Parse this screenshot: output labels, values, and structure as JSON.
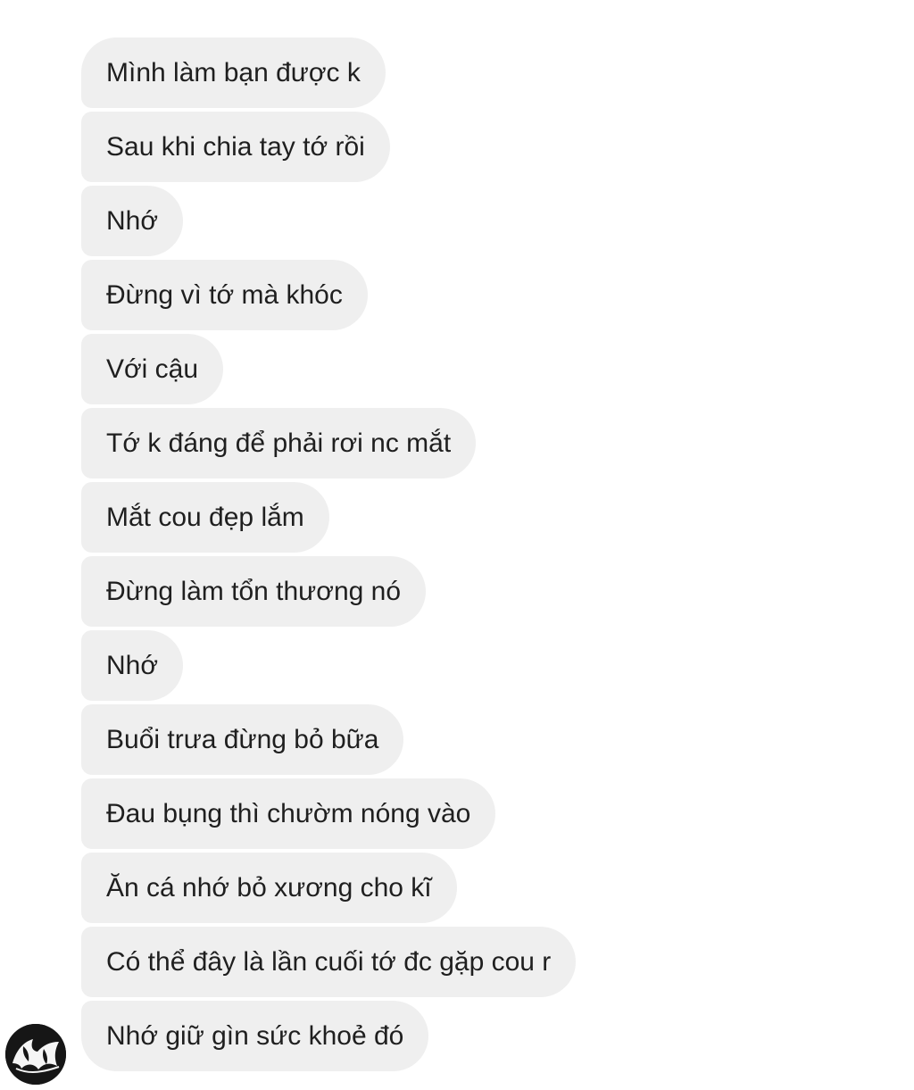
{
  "conversation": {
    "messages": [
      {
        "text": "Mình làm bạn được k"
      },
      {
        "text": "Sau khi chia tay tớ rồi"
      },
      {
        "text": "Nhớ"
      },
      {
        "text": "Đừng vì tớ mà khóc"
      },
      {
        "text": "Với cậu"
      },
      {
        "text": "Tớ k đáng để phải rơi nc mắt"
      },
      {
        "text": "Mắt cou đẹp lắm"
      },
      {
        "text": "Đừng làm tổn thương nó"
      },
      {
        "text": "Nhớ"
      },
      {
        "text": "Buổi trưa đừng bỏ bữa"
      },
      {
        "text": "Đau bụng thì chườm nóng vào"
      },
      {
        "text": "Ăn cá nhớ bỏ xương cho kĩ"
      },
      {
        "text": "Có thể đây là lần cuối tớ đc gặp cou r"
      },
      {
        "text": "Nhớ giữ gìn sức khoẻ đó"
      }
    ]
  },
  "sender": {
    "avatar_icon": "black-white-profile-avatar-icon"
  },
  "colors": {
    "bubble_background": "#efefef",
    "message_text": "#1f1f1f",
    "page_background": "#ffffff"
  }
}
